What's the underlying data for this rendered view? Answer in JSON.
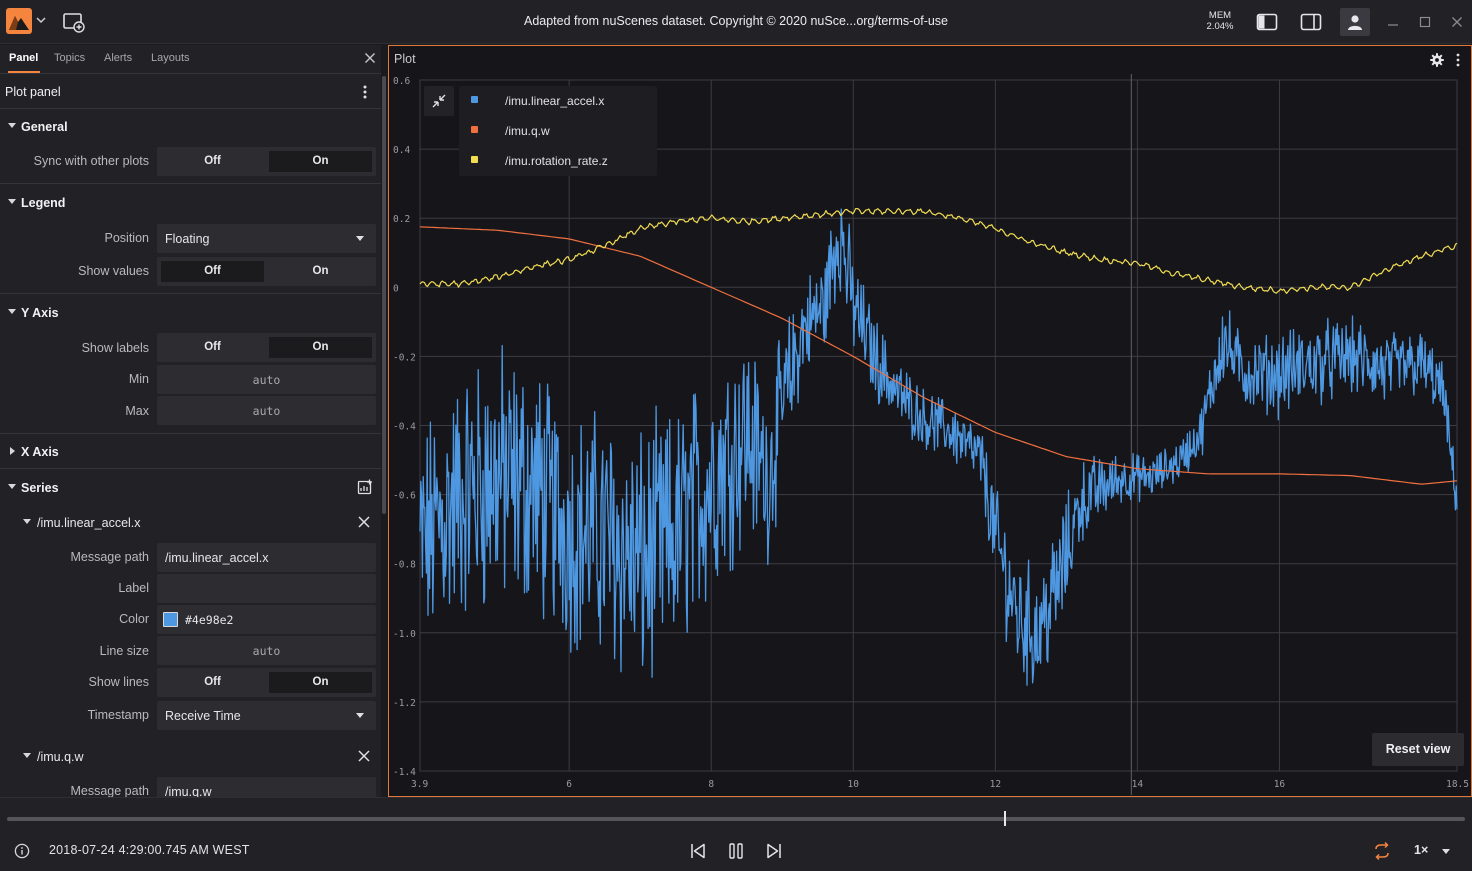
{
  "header": {
    "title": "Adapted from nuScenes dataset. Copyright © 2020 nuSce...org/terms-of-use",
    "mem_label": "MEM",
    "mem_value": "2.04%",
    "accent_color": "#f5843f"
  },
  "sidebar": {
    "tabs": [
      {
        "label": "Panel",
        "active": true
      },
      {
        "label": "Topics",
        "active": false
      },
      {
        "label": "Alerts",
        "active": false
      },
      {
        "label": "Layouts",
        "active": false
      }
    ],
    "panel_title": "Plot panel",
    "general": {
      "title": "General",
      "sync_label": "Sync with other plots",
      "sync_off": "Off",
      "sync_on": "On"
    },
    "legend": {
      "title": "Legend",
      "position_label": "Position",
      "position_value": "Floating",
      "show_values_label": "Show values",
      "show_values_off": "Off",
      "show_values_on": "On"
    },
    "y_axis": {
      "title": "Y Axis",
      "show_labels_label": "Show labels",
      "show_labels_off": "Off",
      "show_labels_on": "On",
      "min_label": "Min",
      "min_placeholder": "auto",
      "max_label": "Max",
      "max_placeholder": "auto"
    },
    "x_axis": {
      "title": "X Axis"
    },
    "series": {
      "title": "Series",
      "items": [
        {
          "name": "/imu.linear_accel.x",
          "message_path_label": "Message path",
          "message_path": "/imu.linear_accel.x",
          "label_label": "Label",
          "label_value": "",
          "color_label": "Color",
          "color": "#4e98e2",
          "line_size_label": "Line size",
          "line_size_placeholder": "auto",
          "show_lines_label": "Show lines",
          "show_lines_off": "Off",
          "show_lines_on": "On",
          "timestamp_label": "Timestamp",
          "timestamp_value": "Receive Time"
        },
        {
          "name": "/imu.q.w",
          "message_path_label": "Message path",
          "message_path": "/imu.q.w"
        }
      ]
    }
  },
  "plot": {
    "title": "Plot",
    "reset_view": "Reset view",
    "legend": [
      {
        "label": "/imu.linear_accel.x",
        "color": "#4e98e2"
      },
      {
        "label": "/imu.q.w",
        "color": "#f0703f"
      },
      {
        "label": "/imu.rotation_rate.z",
        "color": "#f2dd52"
      }
    ]
  },
  "chart_data": {
    "type": "line",
    "title": "",
    "xlim": [
      3.9,
      18.5
    ],
    "ylim": [
      -1.4,
      0.6
    ],
    "x_ticks": [
      "3.9",
      "6",
      "8",
      "10",
      "12",
      "14",
      "16",
      "18.5"
    ],
    "y_ticks": [
      "0.6",
      "0.4",
      "0.2",
      "0",
      "-0.2",
      "-0.4",
      "-0.6",
      "-0.8",
      "-1.0",
      "-1.2",
      "-1.4"
    ],
    "grid": true,
    "legend_position": "top-left",
    "series": [
      {
        "name": "/imu.linear_accel.x",
        "color": "#4e98e2",
        "style": "noisy",
        "x": [
          3.9,
          4.5,
          5.0,
          5.5,
          6.0,
          6.5,
          7.0,
          7.5,
          8.0,
          8.5,
          8.8,
          9.0,
          9.3,
          9.6,
          9.8,
          10.0,
          10.3,
          10.6,
          11.0,
          11.4,
          11.8,
          12.0,
          12.3,
          12.6,
          12.9,
          13.2,
          13.5,
          13.8,
          14.2,
          14.6,
          14.9,
          15.2,
          15.5,
          16.0,
          16.5,
          17.0,
          17.5,
          18.0,
          18.3,
          18.5
        ],
        "y": [
          -0.75,
          -0.6,
          -0.55,
          -0.58,
          -0.7,
          -0.72,
          -0.8,
          -0.72,
          -0.55,
          -0.42,
          -0.55,
          -0.35,
          -0.12,
          -0.05,
          0.18,
          -0.05,
          -0.2,
          -0.3,
          -0.38,
          -0.42,
          -0.5,
          -0.72,
          -0.95,
          -1.0,
          -0.85,
          -0.62,
          -0.58,
          -0.55,
          -0.55,
          -0.5,
          -0.42,
          -0.15,
          -0.25,
          -0.25,
          -0.22,
          -0.2,
          -0.24,
          -0.22,
          -0.3,
          -0.62
        ],
        "noise": [
          0.28,
          0.3,
          0.32,
          0.3,
          0.28,
          0.3,
          0.32,
          0.3,
          0.28,
          0.25,
          0.2,
          0.18,
          0.12,
          0.12,
          0.15,
          0.12,
          0.1,
          0.08,
          0.07,
          0.07,
          0.08,
          0.12,
          0.15,
          0.15,
          0.15,
          0.1,
          0.08,
          0.06,
          0.05,
          0.05,
          0.06,
          0.1,
          0.08,
          0.1,
          0.1,
          0.09,
          0.09,
          0.08,
          0.07,
          0.05
        ]
      },
      {
        "name": "/imu.q.w",
        "color": "#f0703f",
        "style": "smooth",
        "x": [
          3.9,
          5.0,
          6.0,
          7.0,
          8.0,
          9.0,
          10.0,
          11.0,
          12.0,
          13.0,
          14.0,
          15.0,
          16.0,
          17.0,
          18.0,
          18.5
        ],
        "y": [
          0.175,
          0.165,
          0.14,
          0.09,
          0.0,
          -0.09,
          -0.2,
          -0.32,
          -0.42,
          -0.49,
          -0.525,
          -0.54,
          -0.54,
          -0.545,
          -0.57,
          -0.56
        ]
      },
      {
        "name": "/imu.rotation_rate.z",
        "color": "#f2dd52",
        "style": "wiggly",
        "x": [
          3.9,
          4.5,
          5.0,
          5.5,
          6.0,
          6.5,
          7.0,
          7.5,
          8.0,
          8.5,
          9.0,
          9.5,
          10.0,
          10.5,
          11.0,
          11.5,
          12.0,
          12.5,
          13.0,
          13.5,
          14.0,
          14.5,
          15.0,
          15.5,
          16.0,
          16.5,
          17.0,
          17.5,
          18.0,
          18.5
        ],
        "y": [
          0.01,
          0.01,
          0.03,
          0.06,
          0.08,
          0.12,
          0.17,
          0.19,
          0.2,
          0.19,
          0.2,
          0.21,
          0.22,
          0.22,
          0.22,
          0.2,
          0.17,
          0.13,
          0.1,
          0.08,
          0.07,
          0.04,
          0.02,
          0.0,
          -0.01,
          0.0,
          0.0,
          0.05,
          0.09,
          0.12
        ]
      }
    ]
  },
  "bottom": {
    "timestamp": "2018-07-24 4:29:00.745 AM WEST",
    "speed": "1×",
    "progress": 0.686
  }
}
